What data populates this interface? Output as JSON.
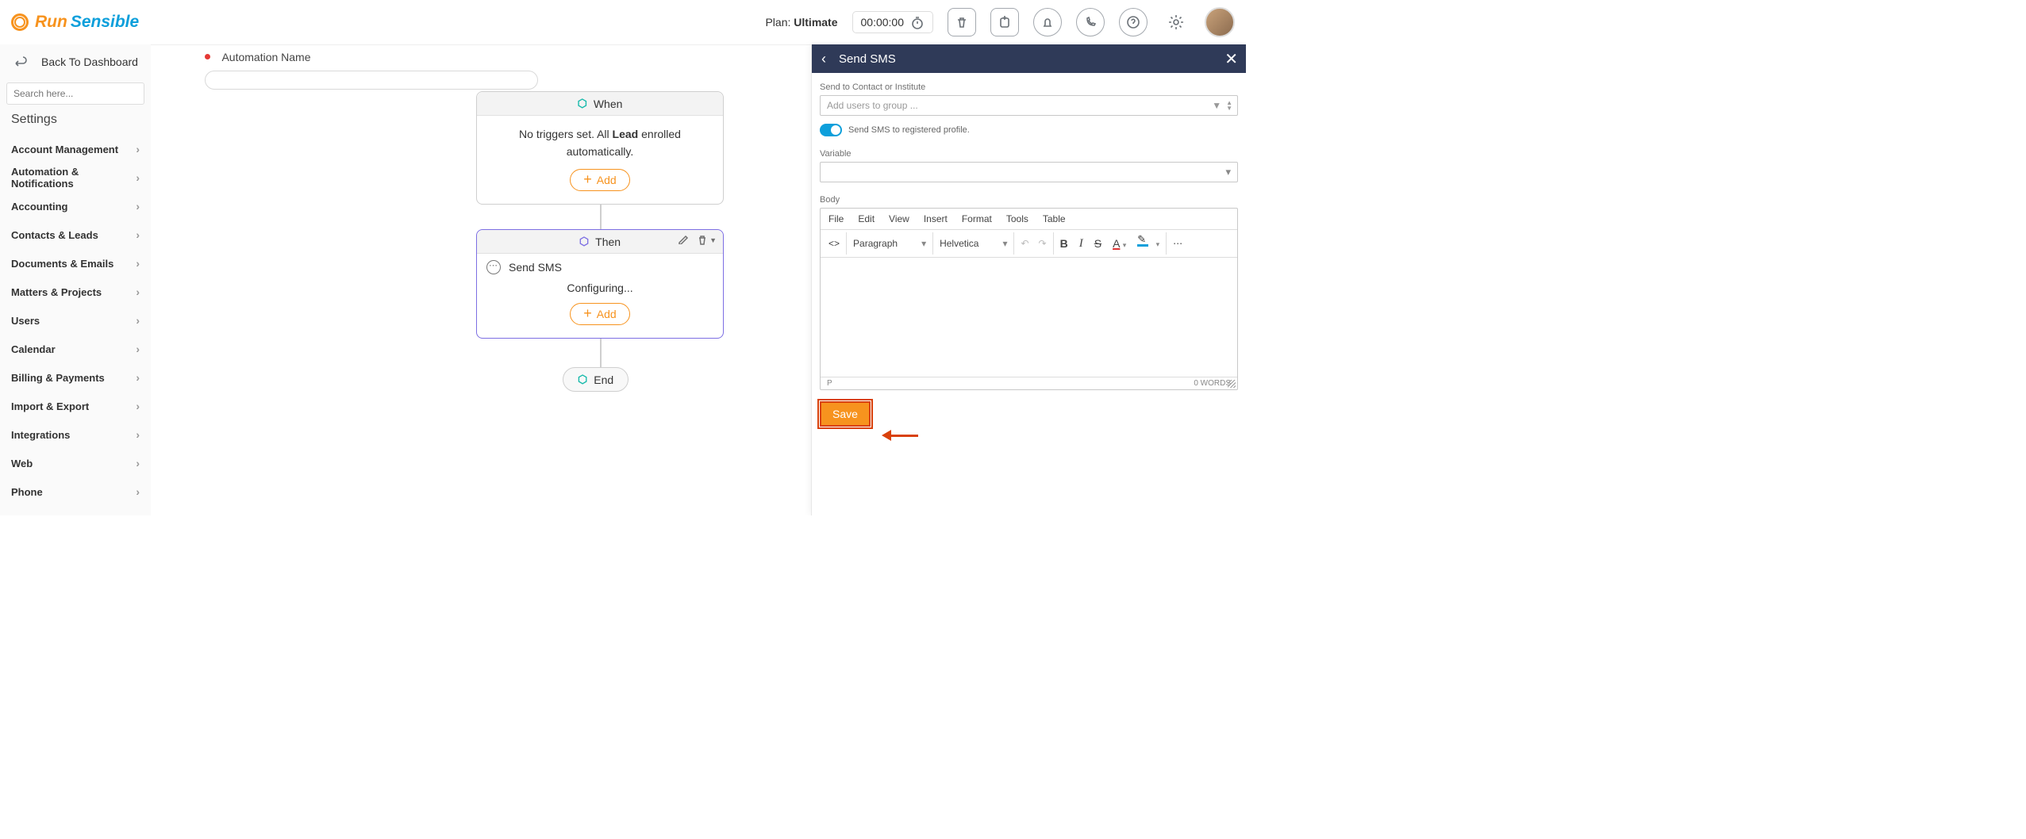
{
  "header": {
    "logo_run": "Run",
    "logo_sensible": "Sensible",
    "plan_prefix": "Plan: ",
    "plan_name": "Ultimate",
    "stopwatch": "00:00:00"
  },
  "sidebar": {
    "back": "Back To Dashboard",
    "search_placeholder": "Search here...",
    "settings_heading": "Settings",
    "items": [
      "Account Management",
      "Automation & Notifications",
      "Accounting",
      "Contacts & Leads",
      "Documents & Emails",
      "Matters & Projects",
      "Users",
      "Calendar",
      "Billing & Payments",
      "Import & Export",
      "Integrations",
      "Web",
      "Phone"
    ]
  },
  "canvas": {
    "name_label": "Automation Name",
    "when": {
      "title": "When",
      "text_pre": "No triggers set. All ",
      "text_bold": "Lead",
      "text_post": " enrolled automatically.",
      "add": "Add"
    },
    "then": {
      "title": "Then",
      "action": "Send SMS",
      "status": "Configuring...",
      "add": "Add"
    },
    "end": "End"
  },
  "panel": {
    "title": "Send SMS",
    "send_to_label": "Send to Contact or Institute",
    "add_users_placeholder": "Add users to group ...",
    "toggle_label": "Send SMS to registered profile.",
    "variable_label": "Variable",
    "body_label": "Body",
    "menus": [
      "File",
      "Edit",
      "View",
      "Insert",
      "Format",
      "Tools",
      "Table"
    ],
    "block_format": "Paragraph",
    "font": "Helvetica",
    "footer_tag": "P",
    "word_count": "0 WORDS",
    "save": "Save"
  }
}
